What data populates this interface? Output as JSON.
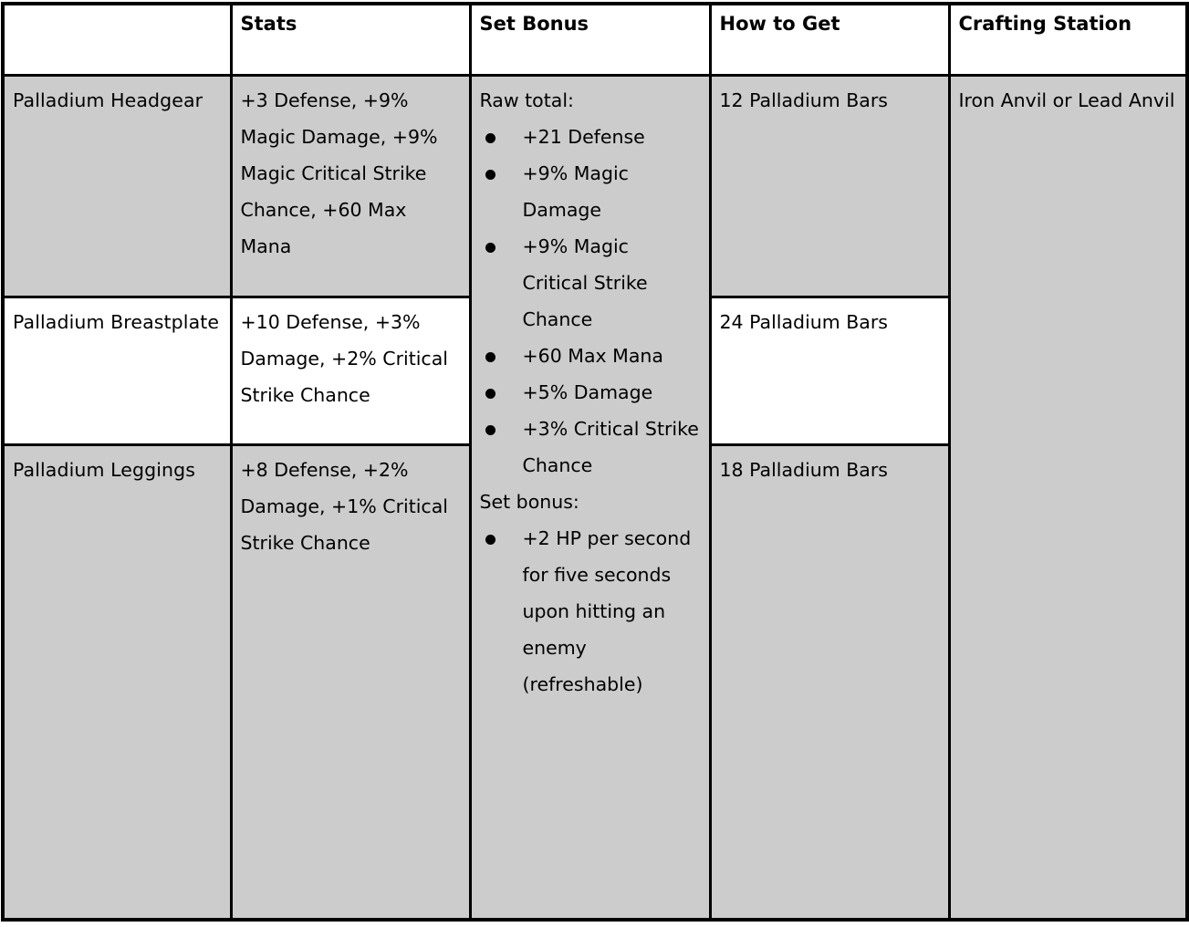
{
  "table": {
    "headers": [
      {
        "label": "",
        "name": "item-name"
      },
      {
        "label": "Stats",
        "name": "stats"
      },
      {
        "label": "Set Bonus",
        "name": "set-bonus"
      },
      {
        "label": "How to Get",
        "name": "how-to-get"
      },
      {
        "label": "Crafting Station",
        "name": "crafting-station"
      }
    ],
    "rows": [
      {
        "item": "Palladium Headgear",
        "stats": "+3 Defense, +9% Magic Damage, +9% Magic Critical Strike Chance, +60 Max Mana",
        "how_to_get": "12 Palladium Bars"
      },
      {
        "item": "Palladium Breastplate",
        "stats": "+10 Defense, +3% Damage, +2% Critical Strike Chance",
        "how_to_get": "24 Palladium Bars"
      },
      {
        "item": "Palladium Leggings",
        "stats": "+8 Defense, +2% Damage, +1% Critical Strike Chance",
        "how_to_get": "18 Palladium Bars"
      }
    ],
    "set_bonus": {
      "raw_total_label": "Raw total:",
      "raw_total_items": [
        "+21 Defense",
        "+9% Magic Damage",
        "+9% Magic Critical Strike Chance",
        "+60 Max Mana",
        "+5% Damage",
        "+3% Critical Strike Chance"
      ],
      "set_bonus_label": "Set bonus:",
      "set_bonus_items": [
        "+2 HP per second for five seconds upon hitting an enemy (refreshable)"
      ]
    },
    "crafting_station": "Iron Anvil or Lead Anvil"
  },
  "colors": {
    "cell_shaded": "#cccccc",
    "cell_light": "#ffffff",
    "border": "#000000",
    "text": "#000000"
  }
}
